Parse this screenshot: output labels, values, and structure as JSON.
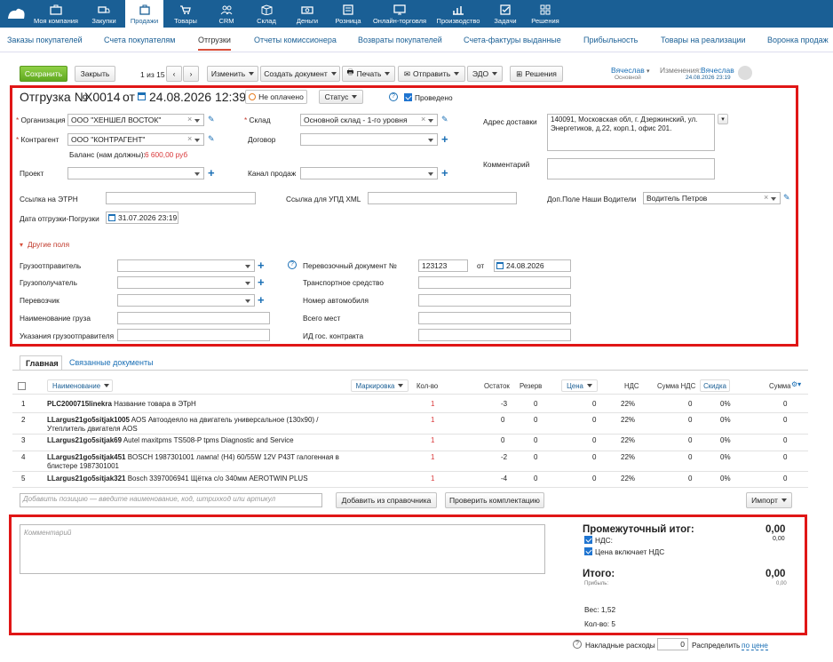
{
  "topnav": {
    "items": [
      "Моя компания",
      "Закупки",
      "Продажи",
      "Товары",
      "CRM",
      "Склад",
      "Деньги",
      "Розница",
      "Онлайн-торговля",
      "Производство",
      "Задачи",
      "Решения"
    ],
    "active": "Продажи"
  },
  "subnav": {
    "items": [
      "Заказы покупателей",
      "Счета покупателям",
      "Отгрузки",
      "Отчеты комиссионера",
      "Возвраты покупателей",
      "Счета-фактуры выданные",
      "Прибыльность",
      "Товары на реализации",
      "Воронка продаж"
    ],
    "active": "Отгрузки"
  },
  "toolbar": {
    "save": "Сохранить",
    "close": "Закрыть",
    "pager": "1 из 15",
    "edit": "Изменить",
    "create": "Создать документ",
    "print": "Печать",
    "send": "Отправить",
    "edo": "ЭДО",
    "solutions": "Решения"
  },
  "user": {
    "name": "Вячеслав",
    "role": "Основной",
    "changes_label": "Изменения:",
    "changed_by": "Вячеслав",
    "changed_at": "24.08.2026 23:19"
  },
  "doc": {
    "title": "Отгрузка №",
    "number": "X0014",
    "from": "от",
    "date": "24.08.2026 12:39",
    "payment_status": "Не оплачено",
    "status_label": "Статус",
    "posted": "Проведено"
  },
  "fields": {
    "org_label": "Организация",
    "org": "ООО \"ХЕНШЕЛ ВОСТОК\"",
    "contractor_label": "Контрагент",
    "contractor": "ООО \"КОНТРАГЕНТ\"",
    "balance_label": "Баланс (нам должны):",
    "balance": "6 600,00 руб",
    "project_label": "Проект",
    "warehouse_label": "Склад",
    "warehouse": "Основной склад - 1-го уровня",
    "contract_label": "Договор",
    "channel_label": "Канал продаж",
    "address_label": "Адрес доставки",
    "address": "140091, Московская обл, г. Дзержинский, ул. Энергетиков, д.22, корп.1, офис 201.",
    "comment_label": "Комментарий",
    "etrn_label": "Ссылка на ЭТРН",
    "upd_label": "Ссылка для УПД XML",
    "drivers_label": "Доп.Поле Наши Водители",
    "driver": "Водитель Петров",
    "ship_date_label": "Дата отгрузки-Погрузки",
    "ship_date": "31.07.2026 23:19",
    "other_fields": "Другие поля",
    "shipper_label": "Грузоотправитель",
    "consignee_label": "Грузополучатель",
    "carrier_label": "Перевозчик",
    "cargo_name_label": "Наименование груза",
    "shipper_notes_label": "Указания грузоотправителя",
    "transport_doc_label": "Перевозочный документ №",
    "transport_doc": "123123",
    "transport_from": "от",
    "transport_date": "24.08.2026",
    "vehicle_label": "Транспортное средство",
    "car_number_label": "Номер автомобиля",
    "places_label": "Всего мест",
    "contract_id_label": "ИД гос. контракта"
  },
  "tabs": {
    "main": "Главная",
    "linked": "Связанные документы"
  },
  "table": {
    "headers": {
      "name": "Наименование",
      "marking": "Маркировка",
      "qty": "Кол-во",
      "stock": "Остаток",
      "reserve": "Резерв",
      "price": "Цена",
      "vat": "НДС",
      "vat_sum": "Сумма НДС",
      "discount": "Скидка",
      "sum": "Сумма"
    },
    "rows": [
      {
        "n": "1",
        "code": "PLC2000715linekra",
        "name": "Название товара в ЭТрН",
        "name2": "",
        "qty": "1",
        "stock": "-3",
        "reserve": "0",
        "price": "0",
        "vat": "22%",
        "vat_sum": "0",
        "discount": "0%",
        "sum": "0"
      },
      {
        "n": "2",
        "code": "LLargus21go5sitjak1005",
        "name": "AOS Автоодеяло на двигатель универсальное (130х90) /",
        "name2": "Утеплитель двигателя AOS",
        "qty": "1",
        "stock": "0",
        "reserve": "0",
        "price": "0",
        "vat": "22%",
        "vat_sum": "0",
        "discount": "0%",
        "sum": "0"
      },
      {
        "n": "3",
        "code": "LLargus21go5sitjak69",
        "name": "Autel maxitpms TS508-P tpms Diagnostic and Service",
        "name2": "",
        "qty": "1",
        "stock": "0",
        "reserve": "0",
        "price": "0",
        "vat": "22%",
        "vat_sum": "0",
        "discount": "0%",
        "sum": "0"
      },
      {
        "n": "4",
        "code": "LLargus21go5sitjak451",
        "name": "BOSCH 1987301001 лампа! (H4) 60/55W 12V P43T галогенная в",
        "name2": "блистере 1987301001",
        "qty": "1",
        "stock": "-2",
        "reserve": "0",
        "price": "0",
        "vat": "22%",
        "vat_sum": "0",
        "discount": "0%",
        "sum": "0"
      },
      {
        "n": "5",
        "code": "LLargus21go5sitjak321",
        "name": "Bosch 3397006941 Щётка с/о 340мм AEROTWIN PLUS",
        "name2": "",
        "qty": "1",
        "stock": "-4",
        "reserve": "0",
        "price": "0",
        "vat": "22%",
        "vat_sum": "0",
        "discount": "0%",
        "sum": "0"
      }
    ]
  },
  "add": {
    "placeholder": "Добавить позицию — введите наименование, код, штрихкод или артикул",
    "from_catalog": "Добавить из справочника",
    "check_kit": "Проверить комплектацию",
    "import": "Импорт"
  },
  "totals": {
    "comment_placeholder": "Комментарий",
    "subtotal_label": "Промежуточный итог:",
    "subtotal": "0,00",
    "vat_label": "НДС:",
    "vat": "0,00",
    "price_incl_vat": "Цена включает НДС",
    "total_label": "Итого:",
    "total": "0,00",
    "profit_label": "Прибыль:",
    "profit": "0,00",
    "weight": "Вес: 1,52",
    "count": "Кол-во: 5"
  },
  "overhead": {
    "label": "Накладные расходы",
    "value": "0",
    "distribute": "Распределить",
    "by": "по цене"
  },
  "colors": {
    "nav": "#1a5f95",
    "accent": "#1a6fb5",
    "highlight": "#e01616",
    "save": "#6cb52a"
  }
}
